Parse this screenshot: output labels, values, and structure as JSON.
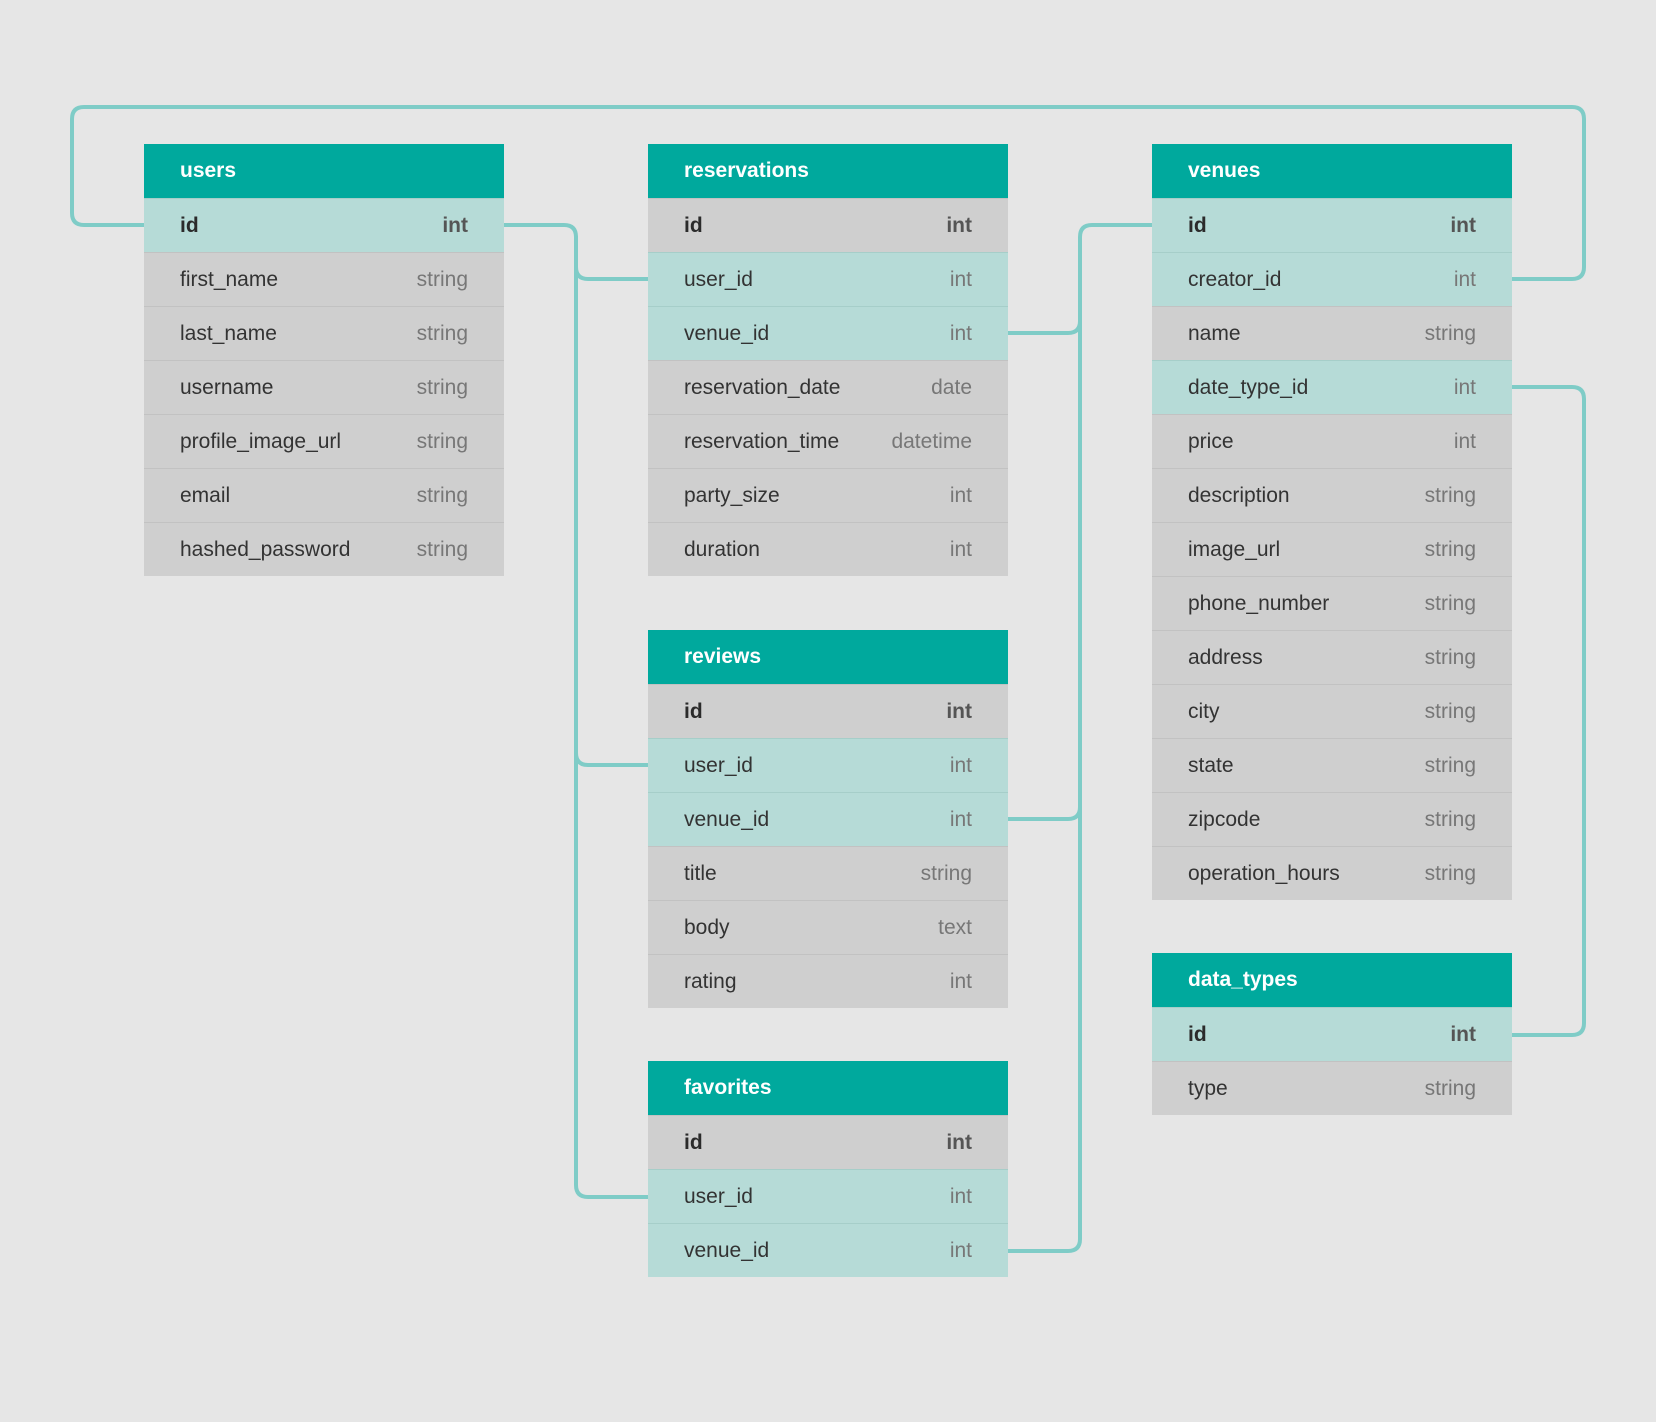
{
  "tables": [
    {
      "key": "users",
      "title": "users",
      "fields": [
        {
          "name": "id",
          "type": "int",
          "pk": true,
          "link": true
        },
        {
          "name": "first_name",
          "type": "string"
        },
        {
          "name": "last_name",
          "type": "string"
        },
        {
          "name": "username",
          "type": "string"
        },
        {
          "name": "profile_image_url",
          "type": "string"
        },
        {
          "name": "email",
          "type": "string"
        },
        {
          "name": "hashed_password",
          "type": "string"
        }
      ]
    },
    {
      "key": "reservations",
      "title": "reservations",
      "fields": [
        {
          "name": "id",
          "type": "int",
          "pk": true
        },
        {
          "name": "user_id",
          "type": "int",
          "link": true
        },
        {
          "name": "venue_id",
          "type": "int",
          "link": true
        },
        {
          "name": "reservation_date",
          "type": "date"
        },
        {
          "name": "reservation_time",
          "type": "datetime"
        },
        {
          "name": "party_size",
          "type": "int"
        },
        {
          "name": "duration",
          "type": "int"
        }
      ]
    },
    {
      "key": "venues",
      "title": "venues",
      "fields": [
        {
          "name": "id",
          "type": "int",
          "pk": true,
          "link": true
        },
        {
          "name": "creator_id",
          "type": "int",
          "link": true
        },
        {
          "name": "name",
          "type": "string"
        },
        {
          "name": "date_type_id",
          "type": "int",
          "link": true
        },
        {
          "name": "price",
          "type": "int"
        },
        {
          "name": "description",
          "type": "string"
        },
        {
          "name": "image_url",
          "type": "string"
        },
        {
          "name": "phone_number",
          "type": "string"
        },
        {
          "name": "address",
          "type": "string"
        },
        {
          "name": "city",
          "type": "string"
        },
        {
          "name": "state",
          "type": "string"
        },
        {
          "name": "zipcode",
          "type": "string"
        },
        {
          "name": "operation_hours",
          "type": "string"
        }
      ]
    },
    {
      "key": "reviews",
      "title": "reviews",
      "fields": [
        {
          "name": "id",
          "type": "int",
          "pk": true
        },
        {
          "name": "user_id",
          "type": "int",
          "link": true
        },
        {
          "name": "venue_id",
          "type": "int",
          "link": true
        },
        {
          "name": "title",
          "type": "string"
        },
        {
          "name": "body",
          "type": "text"
        },
        {
          "name": "rating",
          "type": "int"
        }
      ]
    },
    {
      "key": "favorites",
      "title": "favorites",
      "fields": [
        {
          "name": "id",
          "type": "int",
          "pk": true
        },
        {
          "name": "user_id",
          "type": "int",
          "link": true
        },
        {
          "name": "venue_id",
          "type": "int",
          "link": true
        }
      ]
    },
    {
      "key": "data_types",
      "title": "data_types",
      "fields": [
        {
          "name": "id",
          "type": "int",
          "pk": true,
          "link": true
        },
        {
          "name": "type",
          "type": "string"
        }
      ]
    }
  ],
  "colors": {
    "header": "#00a99d",
    "linked_row": "#b6dbd7",
    "row": "#cfcfcf",
    "connector": "#7fccc7",
    "background": "#e6e6e6"
  }
}
